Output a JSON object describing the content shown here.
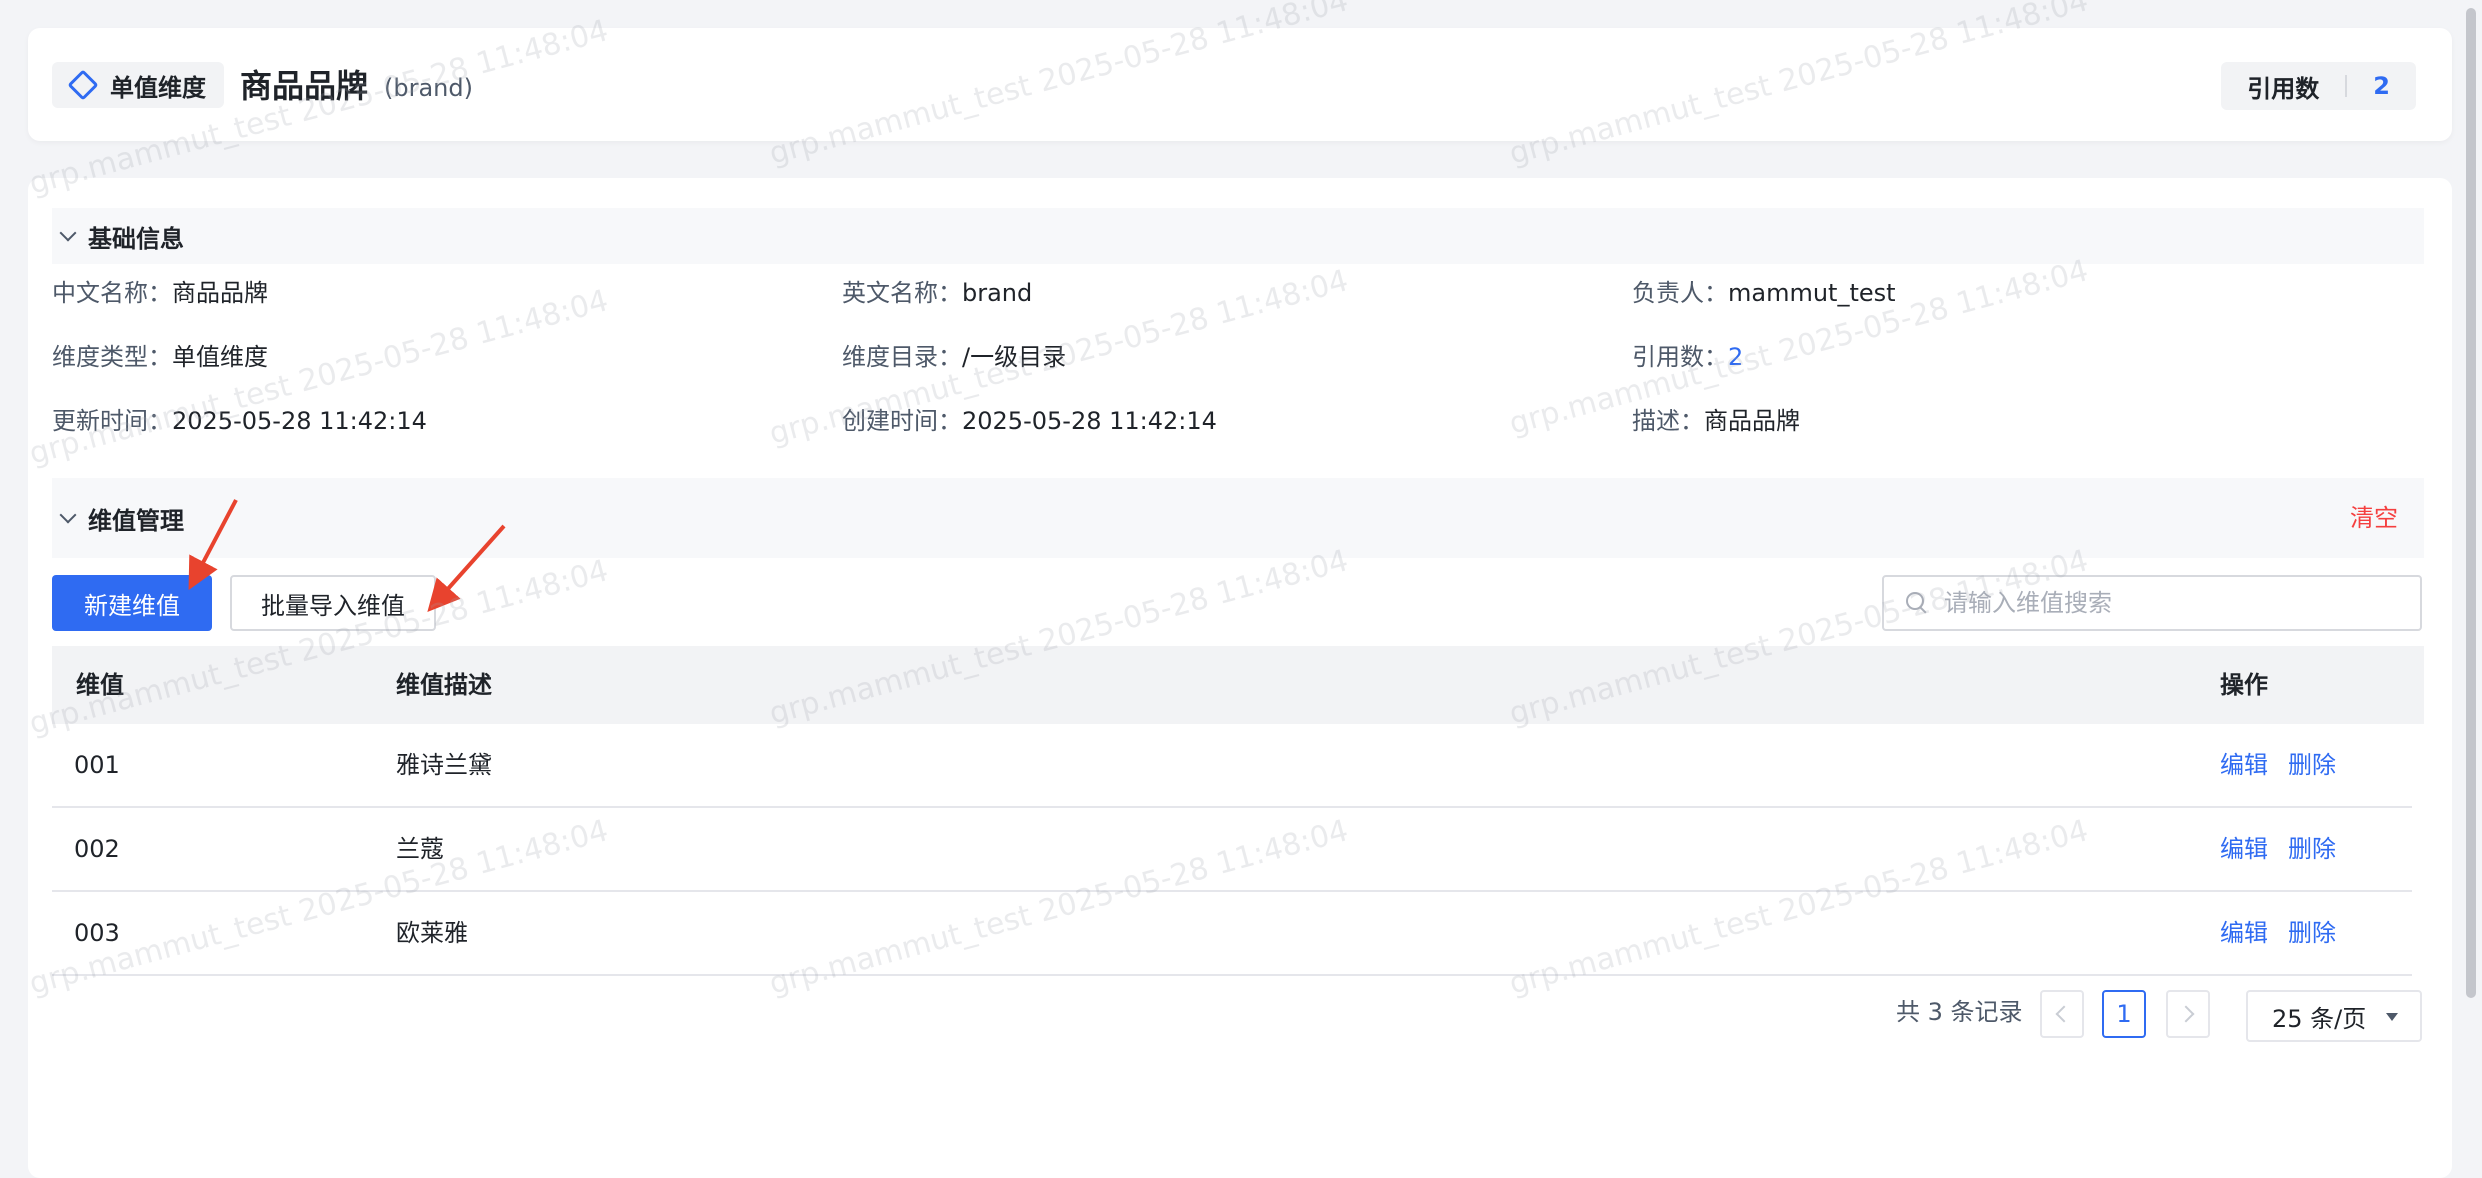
{
  "header": {
    "type_tag": "单值维度",
    "title_cn": "商品品牌",
    "title_en": "(brand)",
    "ref_label": "引用数",
    "ref_value": "2"
  },
  "basic_info": {
    "section_title": "基础信息",
    "items": [
      {
        "key": "中文名称：",
        "value": "商品品牌"
      },
      {
        "key": "英文名称：",
        "value": "brand"
      },
      {
        "key": "负责人：",
        "value": "mammut_test"
      },
      {
        "key": "维度类型：",
        "value": "单值维度"
      },
      {
        "key": "维度目录：",
        "value": "/一级目录"
      },
      {
        "key": "引用数：",
        "value": "2"
      },
      {
        "key": "更新时间：",
        "value": "2025-05-28 11:42:14"
      },
      {
        "key": "创建时间：",
        "value": "2025-05-28 11:42:14"
      },
      {
        "key": "描述：",
        "value": "商品品牌"
      }
    ]
  },
  "value_mgmt": {
    "section_title": "维值管理",
    "clear_label": "清空",
    "new_button": "新建维值",
    "import_button": "批量导入维值",
    "search_placeholder": "请输入维值搜索"
  },
  "table": {
    "columns": [
      "维值",
      "维值描述",
      "操作"
    ],
    "rows": [
      {
        "value": "001",
        "desc": "雅诗兰黛",
        "edit": "编辑",
        "delete": "删除"
      },
      {
        "value": "002",
        "desc": "兰蔻",
        "edit": "编辑",
        "delete": "删除"
      },
      {
        "value": "003",
        "desc": "欧莱雅",
        "edit": "编辑",
        "delete": "删除"
      }
    ]
  },
  "pagination": {
    "total_text": "共 3 条记录",
    "current_page": "1",
    "page_size": "25 条/页"
  },
  "watermark": "grp.mammut_test 2025-05-28 11:48:04",
  "colors": {
    "primary": "#2f6bf2",
    "danger": "#f53f3f",
    "annotation_arrow": "#e8432e"
  }
}
